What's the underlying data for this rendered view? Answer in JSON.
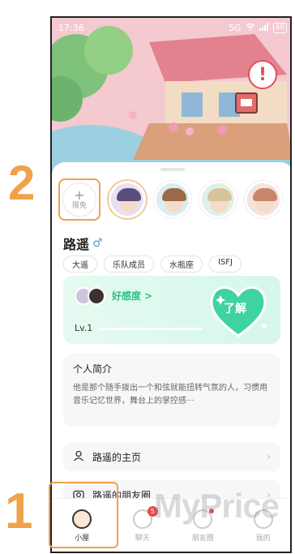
{
  "annotations": {
    "step_two": "2",
    "step_one": "1"
  },
  "status_bar": {
    "time": "17:36",
    "network": "5G",
    "battery": "48"
  },
  "scene": {
    "alert_mark": "!"
  },
  "friends": {
    "add_plus": "+",
    "add_label": "限免",
    "avatar_icons": [
      "avatar-1",
      "avatar-2",
      "avatar-3",
      "avatar-4"
    ]
  },
  "profile": {
    "name": "路遥",
    "gender_symbol": "♂",
    "tags": [
      "大遥",
      "乐队成员",
      "水瓶座",
      "ISFJ"
    ]
  },
  "favorability": {
    "label": "好感度 >",
    "level": "Lv.1",
    "button": "了解",
    "accent_color": "#2fbf86"
  },
  "intro": {
    "title": "个人简介",
    "text": "他是那个随手拨出一个和弦就能扭转气氛的人，习惯用音乐记忆世界，舞台上的掌控感···"
  },
  "links": {
    "homepage": "路遥的主页",
    "moments": "路遥的朋友圈"
  },
  "tabs": [
    {
      "label": "小屋",
      "active": true,
      "badge": ""
    },
    {
      "label": "聊天",
      "active": false,
      "badge": "5"
    },
    {
      "label": "朋友圈",
      "active": false,
      "badge": ""
    },
    {
      "label": "我的",
      "active": false,
      "badge": ""
    }
  ],
  "watermark": "MyPrice"
}
